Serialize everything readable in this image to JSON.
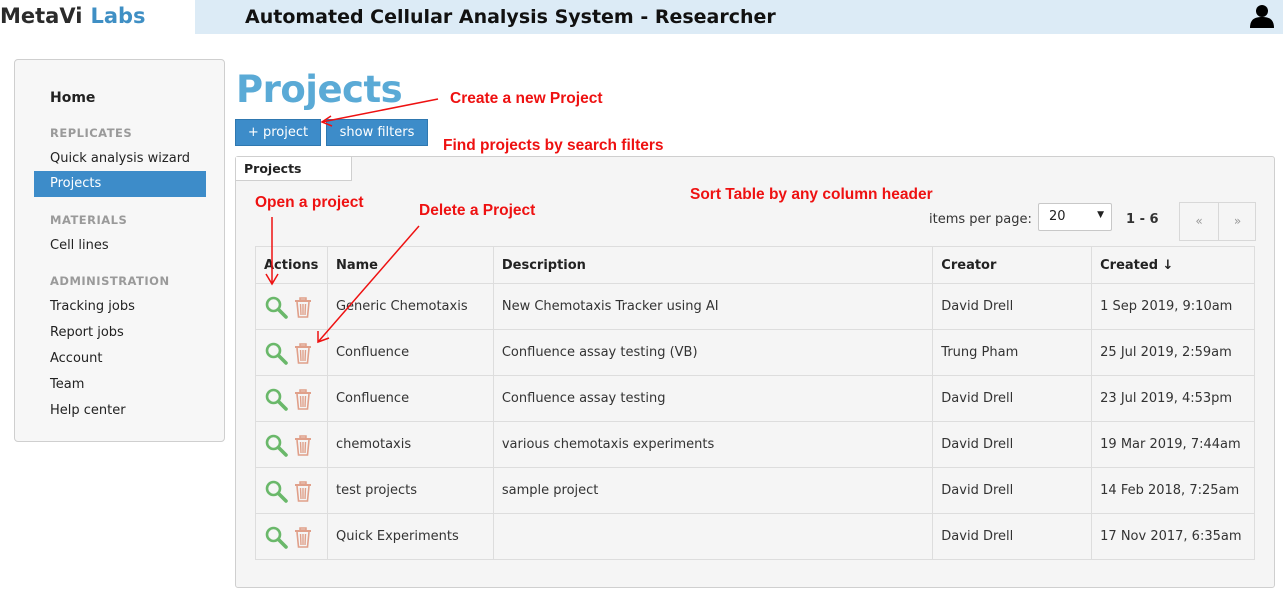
{
  "brand": {
    "part1": "MetaVi",
    "part2": "Labs"
  },
  "header": {
    "title": "Automated Cellular Analysis System - Researcher",
    "user_icon": "user-icon"
  },
  "sidebar": {
    "home": "Home",
    "sections": [
      {
        "title": "REPLICATES",
        "items": [
          "Quick analysis wizard",
          "Projects"
        ]
      },
      {
        "title": "MATERIALS",
        "items": [
          "Cell lines"
        ]
      },
      {
        "title": "ADMINISTRATION",
        "items": [
          "Tracking jobs",
          "Report jobs",
          "Account",
          "Team",
          "Help center"
        ]
      }
    ],
    "active": "Projects"
  },
  "main": {
    "title": "Projects",
    "add_button": "+ project",
    "filters_button": "show filters",
    "tab": "Projects",
    "items_per_page_label": "items per page:",
    "items_per_page_value": "20",
    "range": "1 - 6",
    "prev": "«",
    "next": "»"
  },
  "table": {
    "columns": [
      "Actions",
      "Name",
      "Description",
      "Creator",
      "Created ↓"
    ],
    "rows": [
      {
        "name": "Generic Chemotaxis",
        "description": "New Chemotaxis Tracker using AI",
        "creator": "David Drell",
        "created": "1 Sep 2019, 9:10am"
      },
      {
        "name": "Confluence",
        "description": "Confluence assay testing (VB)",
        "creator": "Trung Pham",
        "created": "25 Jul 2019, 2:59am"
      },
      {
        "name": "Confluence",
        "description": "Confluence assay testing",
        "creator": "David Drell",
        "created": "23 Jul 2019, 4:53pm"
      },
      {
        "name": "chemotaxis",
        "description": "various chemotaxis experiments",
        "creator": "David Drell",
        "created": "19 Mar 2019, 7:44am"
      },
      {
        "name": "test projects",
        "description": "sample project",
        "creator": "David Drell",
        "created": "14 Feb 2018, 7:25am"
      },
      {
        "name": "Quick Experiments",
        "description": "",
        "creator": "David Drell",
        "created": "17 Nov 2017, 6:35am"
      }
    ]
  },
  "annotations": {
    "create": "Create a new Project",
    "filters": "Find projects by search filters",
    "sort": "Sort Table by any column header",
    "open": "Open a project",
    "delete": "Delete a Project"
  },
  "colors": {
    "accent": "#3d8cc9",
    "title": "#5aaad6",
    "annotation": "#ee1111",
    "open_icon": "#6ab86a",
    "delete_icon": "#e0a08a"
  }
}
